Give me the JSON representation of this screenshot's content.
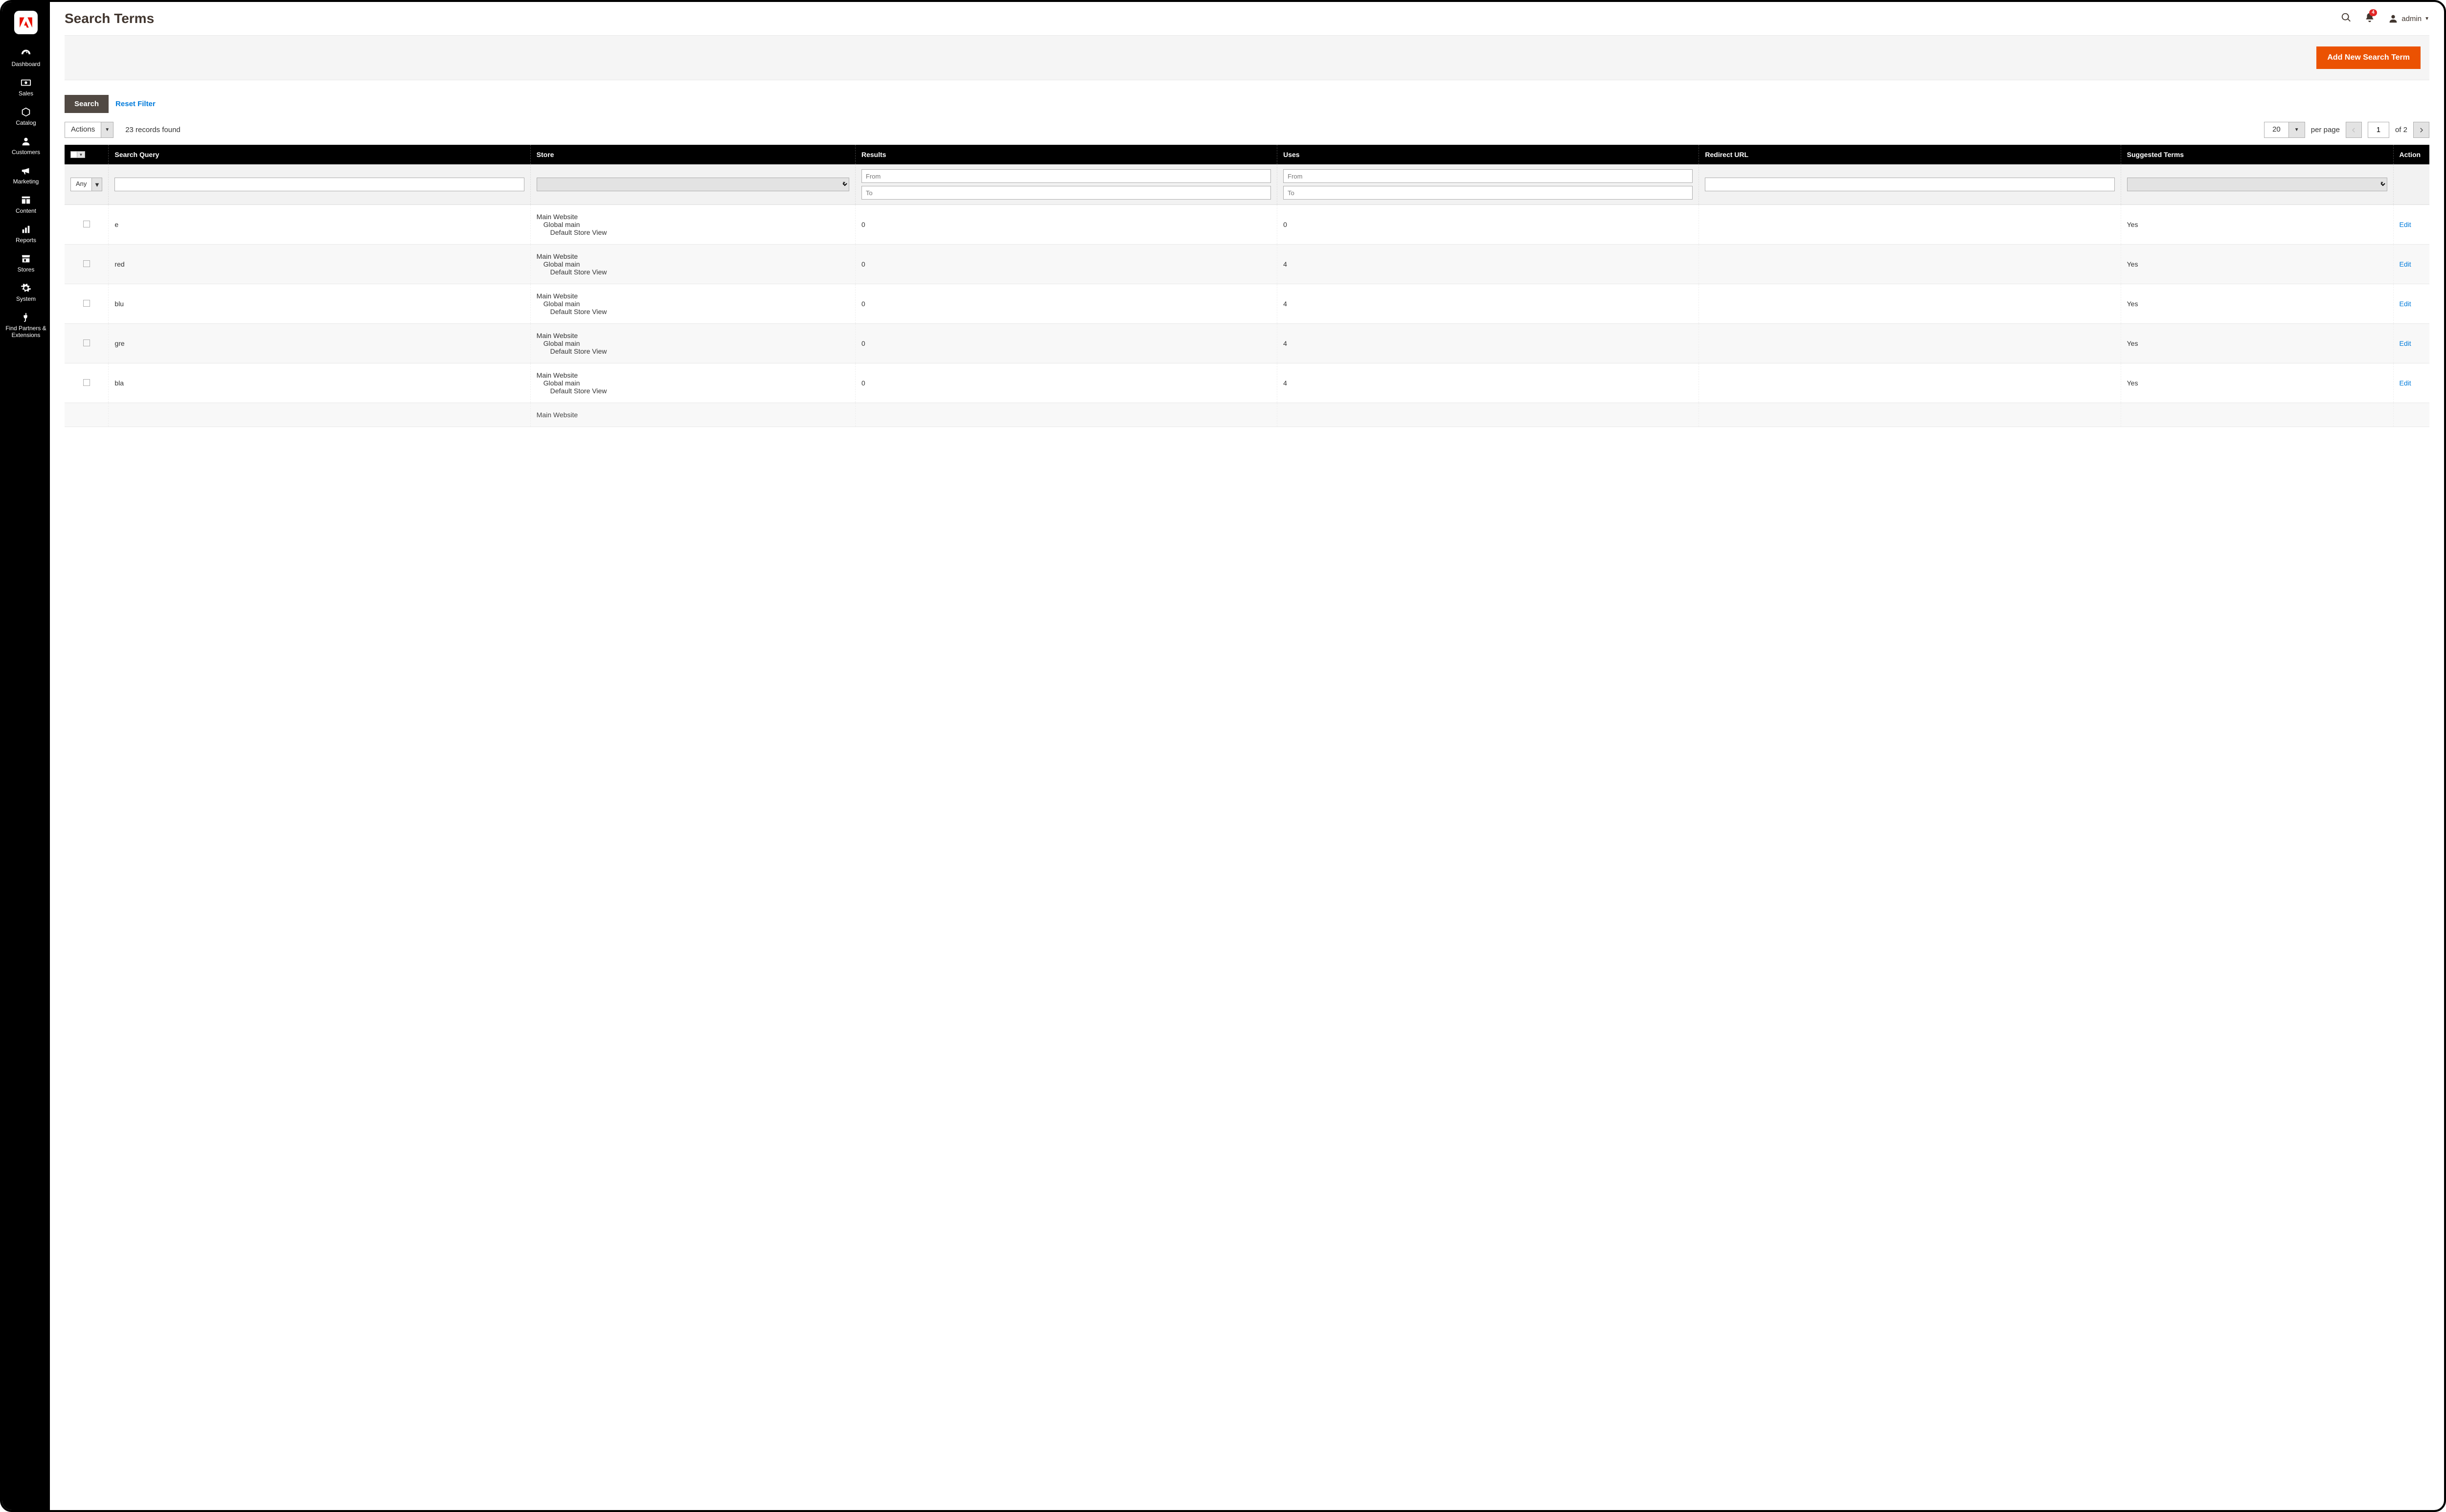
{
  "sidebar": {
    "items": [
      {
        "label": "Dashboard",
        "icon": "dashboard"
      },
      {
        "label": "Sales",
        "icon": "sales"
      },
      {
        "label": "Catalog",
        "icon": "catalog"
      },
      {
        "label": "Customers",
        "icon": "customers"
      },
      {
        "label": "Marketing",
        "icon": "marketing"
      },
      {
        "label": "Content",
        "icon": "content"
      },
      {
        "label": "Reports",
        "icon": "reports"
      },
      {
        "label": "Stores",
        "icon": "stores"
      },
      {
        "label": "System",
        "icon": "system"
      },
      {
        "label": "Find Partners & Extensions",
        "icon": "partners"
      }
    ]
  },
  "header": {
    "title": "Search Terms",
    "notification_count": "4",
    "user_label": "admin"
  },
  "actions_bar": {
    "add_button": "Add New Search Term"
  },
  "filter_bar": {
    "search": "Search",
    "reset": "Reset Filter"
  },
  "grid_controls": {
    "actions_label": "Actions",
    "records_found": "23 records found",
    "per_page_value": "20",
    "per_page_label": "per page",
    "page_current": "1",
    "page_total": "of 2"
  },
  "columns": {
    "search_query": "Search Query",
    "store": "Store",
    "results": "Results",
    "uses": "Uses",
    "redirect_url": "Redirect URL",
    "suggested_terms": "Suggested Terms",
    "action": "Action"
  },
  "filters": {
    "any": "Any",
    "from": "From",
    "to": "To"
  },
  "store_text": {
    "l1": "Main Website",
    "l2": "Global main",
    "l3": "Default Store View"
  },
  "rows": [
    {
      "query": "e",
      "results": "0",
      "uses": "0",
      "redirect": "",
      "suggested": "Yes",
      "action": "Edit"
    },
    {
      "query": "red",
      "results": "0",
      "uses": "4",
      "redirect": "",
      "suggested": "Yes",
      "action": "Edit"
    },
    {
      "query": "blu",
      "results": "0",
      "uses": "4",
      "redirect": "",
      "suggested": "Yes",
      "action": "Edit"
    },
    {
      "query": "gre",
      "results": "0",
      "uses": "4",
      "redirect": "",
      "suggested": "Yes",
      "action": "Edit"
    },
    {
      "query": "bla",
      "results": "0",
      "uses": "4",
      "redirect": "",
      "suggested": "Yes",
      "action": "Edit"
    }
  ]
}
